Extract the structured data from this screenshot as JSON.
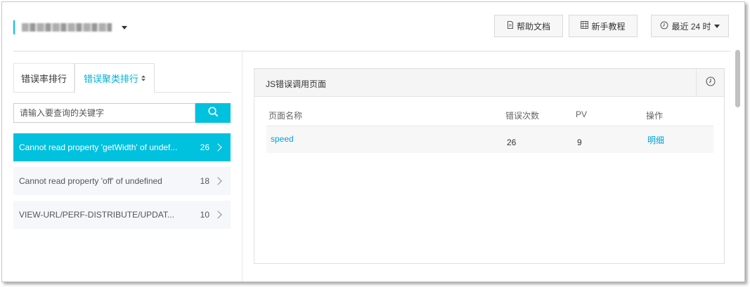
{
  "header": {
    "help_label": "帮助文档",
    "guide_label": "新手教程",
    "time_range_label": "最近 24 时"
  },
  "left": {
    "tabs": [
      {
        "label": "错误率排行"
      },
      {
        "label": "错误聚类排行"
      }
    ],
    "search_placeholder": "请输入要查询的关键字",
    "errors": [
      {
        "message": "Cannot read property 'getWidth' of undef...",
        "count": "26"
      },
      {
        "message": "Cannot read property 'off' of undefined",
        "count": "18"
      },
      {
        "message": "VIEW-URL/PERF-DISTRIBUTE/UPDAT...",
        "count": "10"
      }
    ]
  },
  "panel": {
    "title": "JS错误调用页面",
    "columns": [
      "页面名称",
      "错误次数",
      "PV",
      "操作"
    ],
    "rows": [
      {
        "page": "speed",
        "errors": "26",
        "pv": "9",
        "action": "明细"
      }
    ]
  },
  "colors": {
    "accent": "#00c1de",
    "link": "#00a2d6"
  },
  "icons": [
    "document-icon",
    "guide-icon",
    "clock-icon",
    "search-icon",
    "chevron-right-icon",
    "caret-down-icon",
    "sort-icon"
  ]
}
